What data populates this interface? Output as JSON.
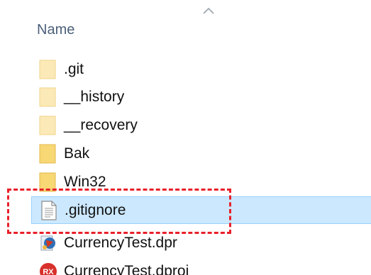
{
  "column_header": {
    "name_label": "Name",
    "sort": "ascending"
  },
  "files": [
    {
      "name": ".git",
      "type": "folder-light"
    },
    {
      "name": "__history",
      "type": "folder-light"
    },
    {
      "name": "__recovery",
      "type": "folder-light"
    },
    {
      "name": "Bak",
      "type": "folder"
    },
    {
      "name": "Win32",
      "type": "folder"
    },
    {
      "name": ".gitignore",
      "type": "text-file",
      "selected": true
    },
    {
      "name": "CurrencyTest.dpr",
      "type": "delphi-project-file"
    },
    {
      "name": "CurrencyTest.dproj",
      "type": "rad-studio-project-file",
      "icon_text": "RX"
    }
  ],
  "colors": {
    "selection_bg": "#cce8ff",
    "selection_border": "#99d1ff",
    "annotation": "#e8202a",
    "folder": "#f8d775",
    "folder_light": "#fbe9b7"
  }
}
